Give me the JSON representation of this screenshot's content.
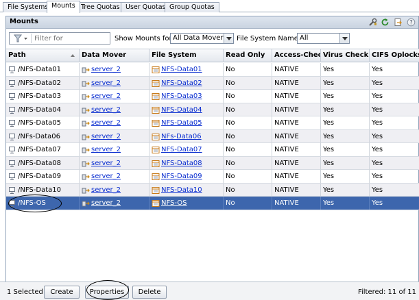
{
  "tabs": [
    {
      "label": "File Systems"
    },
    {
      "label": "Mounts"
    },
    {
      "label": "Tree Quotas"
    },
    {
      "label": "User Quotas"
    },
    {
      "label": "Group Quotas"
    }
  ],
  "panel": {
    "title": "Mounts"
  },
  "filters": {
    "filter_placeholder": "Filter for",
    "show_mounts_label": "Show Mounts for:",
    "show_mounts_value": "All Data Movers",
    "fs_name_label": "File System Name:",
    "fs_name_value": "All"
  },
  "columns": [
    "Path",
    "Data Mover",
    "File System",
    "Read Only",
    "Access-Chec...",
    "Virus Checki...",
    "CIFS Oplocks..."
  ],
  "rows": [
    {
      "path": "/NFS-Data01",
      "mover": "server_2",
      "fs": "NFS-Data01",
      "ro": "No",
      "access": "NATIVE",
      "virus": "Yes",
      "cifs": "Yes"
    },
    {
      "path": "/NFS-Data02",
      "mover": "server_2",
      "fs": "NFS-Data02",
      "ro": "No",
      "access": "NATIVE",
      "virus": "Yes",
      "cifs": "Yes"
    },
    {
      "path": "/NFS-Data03",
      "mover": "server_2",
      "fs": "NFS-Data03",
      "ro": "No",
      "access": "NATIVE",
      "virus": "Yes",
      "cifs": "Yes"
    },
    {
      "path": "/NFS-Data04",
      "mover": "server_2",
      "fs": "NFS-Data04",
      "ro": "No",
      "access": "NATIVE",
      "virus": "Yes",
      "cifs": "Yes"
    },
    {
      "path": "/NFS-Data05",
      "mover": "server_2",
      "fs": "NFS-Data05",
      "ro": "No",
      "access": "NATIVE",
      "virus": "Yes",
      "cifs": "Yes"
    },
    {
      "path": "/NFs-Data06",
      "mover": "server_2",
      "fs": "NFs-Data06",
      "ro": "No",
      "access": "NATIVE",
      "virus": "Yes",
      "cifs": "Yes"
    },
    {
      "path": "/NFS-Data07",
      "mover": "server_2",
      "fs": "NFS-Data07",
      "ro": "No",
      "access": "NATIVE",
      "virus": "Yes",
      "cifs": "Yes"
    },
    {
      "path": "/NFS-Data08",
      "mover": "server_2",
      "fs": "NFS-Data08",
      "ro": "No",
      "access": "NATIVE",
      "virus": "Yes",
      "cifs": "Yes"
    },
    {
      "path": "/NFS-Data09",
      "mover": "server_2",
      "fs": "NFS-Data09",
      "ro": "No",
      "access": "NATIVE",
      "virus": "Yes",
      "cifs": "Yes"
    },
    {
      "path": "/NFS-Data10",
      "mover": "server_2",
      "fs": "NFS-Data10",
      "ro": "No",
      "access": "NATIVE",
      "virus": "Yes",
      "cifs": "Yes"
    },
    {
      "path": "/NFS-OS",
      "mover": "server_2",
      "fs": "NFS-OS",
      "ro": "No",
      "access": "NATIVE",
      "virus": "Yes",
      "cifs": "Yes"
    }
  ],
  "selected_row": 10,
  "footer": {
    "selected_text": "1 Selected",
    "create_label": "Create",
    "properties_label": "Properties",
    "delete_label": "Delete",
    "filtered_text": "Filtered: 11 of 11"
  },
  "colors": {
    "selection": "#3d66ad",
    "link": "#0b2fd0",
    "header": "#c9d3e0"
  },
  "icons": [
    "funnel-icon",
    "wrench-icon",
    "refresh-icon",
    "export-icon",
    "help-icon",
    "mount-path-icon",
    "data-mover-icon",
    "filesystem-icon"
  ]
}
